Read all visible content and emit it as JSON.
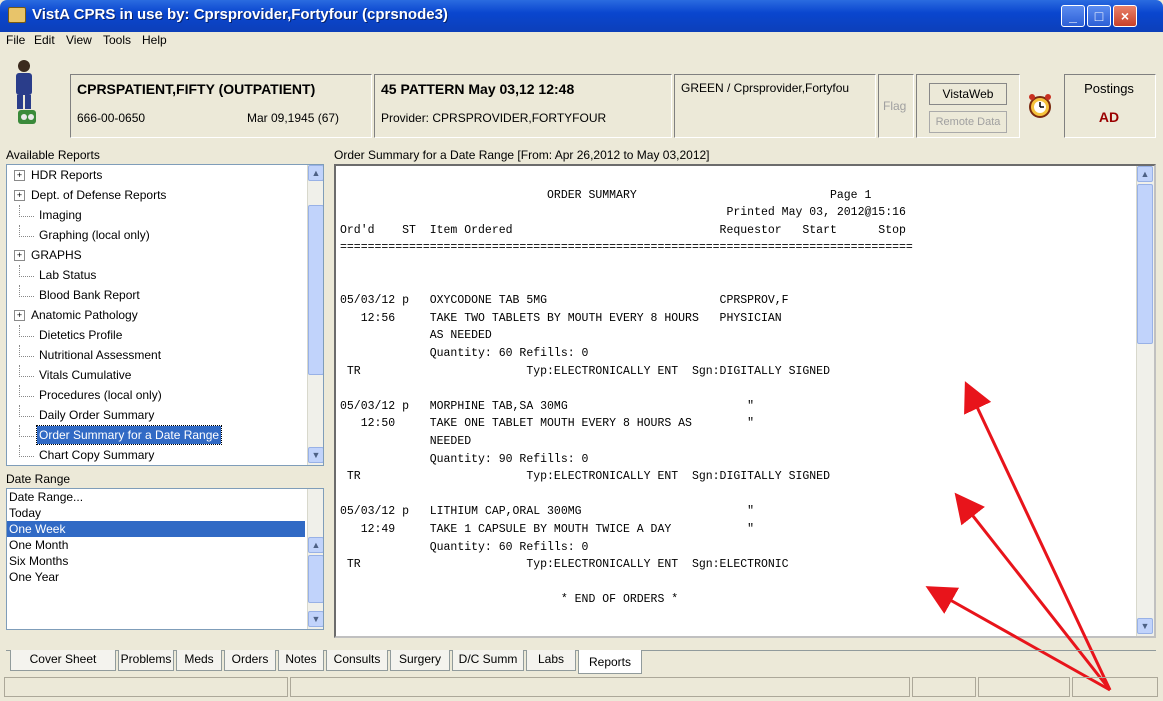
{
  "window": {
    "title": "VistA CPRS in use by: Cprsprovider,Fortyfour  (cprsnode3)",
    "min_label": "_",
    "max_label": "□",
    "close_label": "×"
  },
  "menu": {
    "items": [
      "File",
      "Edit",
      "View",
      "Tools",
      "Help"
    ]
  },
  "patient": {
    "name": "CPRSPATIENT,FIFTY (OUTPATIENT)",
    "ssn": "666-00-0650",
    "dob": "Mar 09,1945 (67)"
  },
  "encounter": {
    "location": "45 PATTERN May 03,12 12:48",
    "provider": "Provider:  CPRSPROVIDER,FORTYFOUR"
  },
  "team": {
    "label": "GREEN / Cprsprovider,Fortyfou"
  },
  "flag": {
    "label": "Flag"
  },
  "vistaweb": {
    "label": "VistaWeb",
    "remote": "Remote Data"
  },
  "postings": {
    "label": "Postings",
    "value": "AD"
  },
  "reports_panel": {
    "label": "Available Reports",
    "items": [
      {
        "label": "HDR Reports",
        "expandable": true
      },
      {
        "label": "Dept. of Defense Reports",
        "expandable": true
      },
      {
        "label": "Imaging",
        "expandable": false
      },
      {
        "label": "Graphing (local only)",
        "expandable": false
      },
      {
        "label": "GRAPHS",
        "expandable": true
      },
      {
        "label": "Lab Status",
        "expandable": false
      },
      {
        "label": "Blood Bank Report",
        "expandable": false
      },
      {
        "label": "Anatomic Pathology",
        "expandable": true
      },
      {
        "label": "Dietetics Profile",
        "expandable": false
      },
      {
        "label": "Nutritional Assessment",
        "expandable": false
      },
      {
        "label": "Vitals Cumulative",
        "expandable": false
      },
      {
        "label": "Procedures (local only)",
        "expandable": false
      },
      {
        "label": "Daily Order Summary",
        "expandable": false
      },
      {
        "label": "Order Summary for a Date Range",
        "expandable": false,
        "selected": true
      },
      {
        "label": "Chart Copy Summary",
        "expandable": false
      }
    ]
  },
  "date_range": {
    "label": "Date Range",
    "items": [
      "Date Range...",
      "Today",
      "One Week",
      "One Month",
      "Six Months",
      "One Year"
    ],
    "selected": "One Week"
  },
  "report": {
    "heading": "Order Summary for a Date Range [From: Apr 26,2012 to May 03,2012]",
    "lines": [
      "",
      "                              ORDER SUMMARY                            Page 1",
      "                                                        Printed May 03, 2012@15:16",
      "Ord'd    ST  Item Ordered                              Requestor   Start      Stop",
      "===================================================================================",
      "",
      "",
      "05/03/12 p   OXYCODONE TAB 5MG                         CPRSPROV,F",
      "   12:56     TAKE TWO TABLETS BY MOUTH EVERY 8 HOURS   PHYSICIAN",
      "             AS NEEDED",
      "             Quantity: 60 Refills: 0",
      " TR                        Typ:ELECTRONICALLY ENT  Sgn:DIGITALLY SIGNED",
      "",
      "05/03/12 p   MORPHINE TAB,SA 30MG                          \"",
      "   12:50     TAKE ONE TABLET MOUTH EVERY 8 HOURS AS        \"",
      "             NEEDED",
      "             Quantity: 90 Refills: 0",
      " TR                        Typ:ELECTRONICALLY ENT  Sgn:DIGITALLY SIGNED",
      "",
      "05/03/12 p   LITHIUM CAP,ORAL 300MG                        \"",
      "   12:49     TAKE 1 CAPSULE BY MOUTH TWICE A DAY           \"",
      "             Quantity: 60 Refills: 0",
      " TR                        Typ:ELECTRONICALLY ENT  Sgn:ELECTRONIC",
      "",
      "                                * END OF ORDERS *"
    ]
  },
  "tabs": [
    "Cover Sheet",
    "Problems",
    "Meds",
    "Orders",
    "Notes",
    "Consults",
    "Surgery",
    "D/C Summ",
    "Labs",
    "Reports"
  ],
  "active_tab": "Reports",
  "colors": {
    "arrow": "#e8141b",
    "selection": "#316ac5",
    "titlebar": "#0a46cf"
  }
}
